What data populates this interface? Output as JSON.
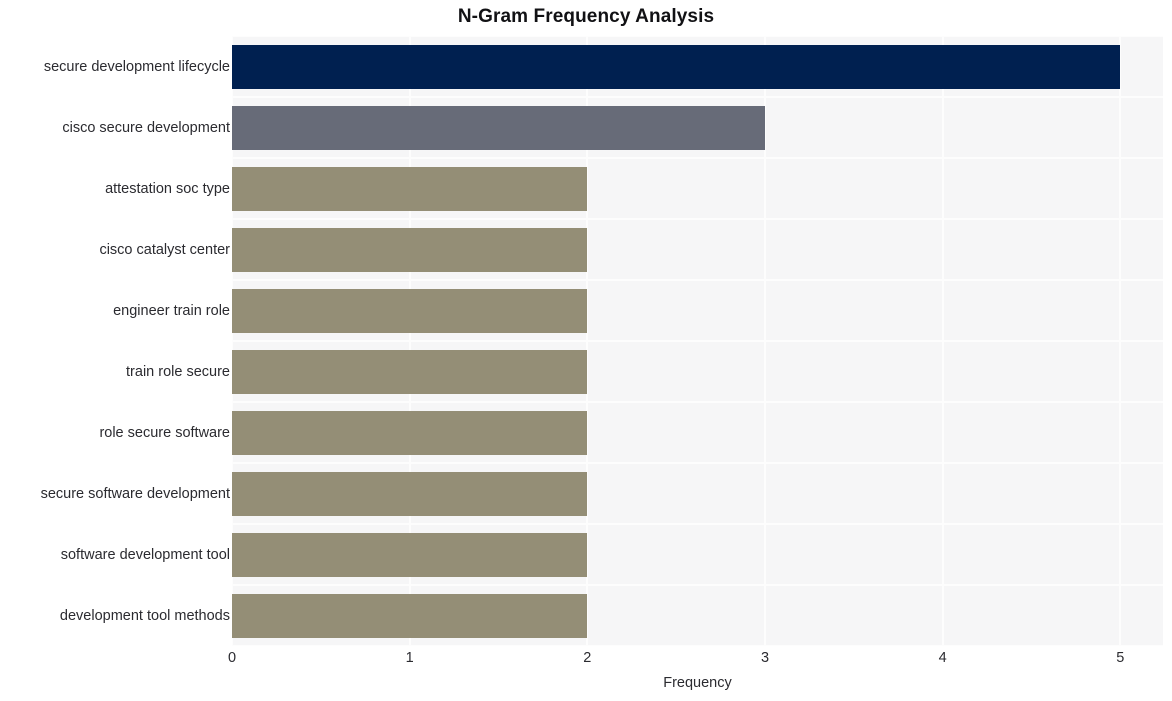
{
  "chart_data": {
    "type": "bar",
    "orientation": "horizontal",
    "title": "N-Gram Frequency Analysis",
    "xlabel": "Frequency",
    "ylabel": "",
    "categories": [
      "secure development lifecycle",
      "cisco secure development",
      "attestation soc type",
      "cisco catalyst center",
      "engineer train role",
      "train role secure",
      "role secure software",
      "secure software development",
      "software development tool",
      "development tool methods"
    ],
    "values": [
      5,
      3,
      2,
      2,
      2,
      2,
      2,
      2,
      2,
      2
    ],
    "bar_colors": [
      "#002050",
      "#676b78",
      "#948e76",
      "#948e76",
      "#948e76",
      "#948e76",
      "#948e76",
      "#948e76",
      "#948e76",
      "#948e76"
    ],
    "xlim": [
      0,
      5.24
    ],
    "xticks": [
      "0",
      "1",
      "2",
      "3",
      "4",
      "5"
    ],
    "xtick_values": [
      0,
      1,
      2,
      3,
      4,
      5
    ],
    "grid": true,
    "legend": "none",
    "plot_background": "#f6f6f7",
    "gridline_color": "#fdfdfd",
    "page_background": "#ffffff",
    "text_color": "#2b2b30",
    "title_color": "#111114"
  }
}
